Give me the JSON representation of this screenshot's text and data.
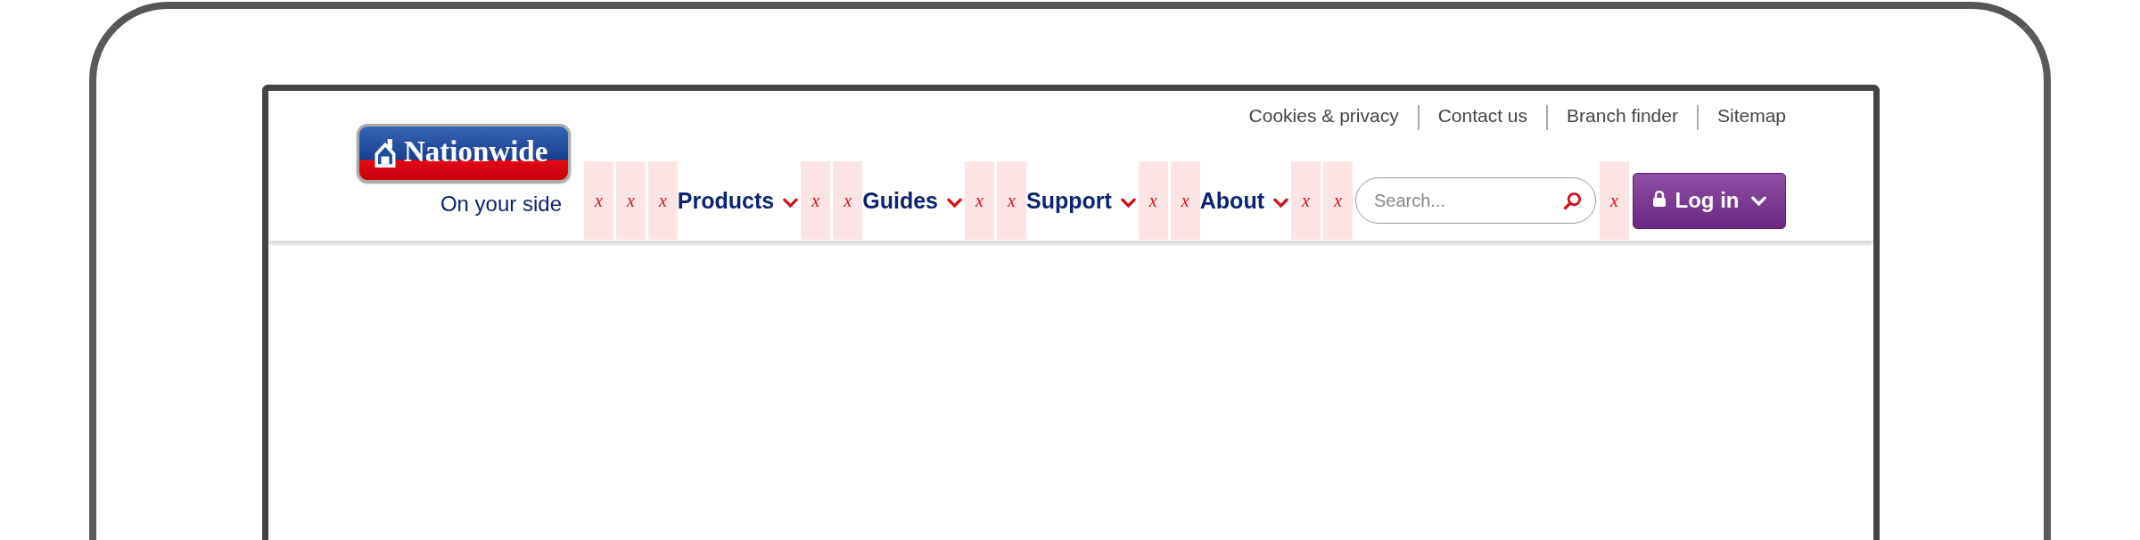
{
  "top_links": [
    "Cookies & privacy",
    "Contact us",
    "Branch finder",
    "Sitemap"
  ],
  "logo": {
    "text": "Nationwide"
  },
  "tagline": "On your side",
  "nav": [
    {
      "kind": "placeholder",
      "text": "x"
    },
    {
      "kind": "placeholder",
      "text": "x"
    },
    {
      "kind": "placeholder",
      "text": "x"
    },
    {
      "kind": "menu",
      "label": "Products"
    },
    {
      "kind": "placeholder",
      "text": "x"
    },
    {
      "kind": "placeholder",
      "text": "x"
    },
    {
      "kind": "menu",
      "label": "Guides"
    },
    {
      "kind": "placeholder",
      "text": "x"
    },
    {
      "kind": "placeholder",
      "text": "x"
    },
    {
      "kind": "menu",
      "label": "Support"
    },
    {
      "kind": "placeholder",
      "text": "x"
    },
    {
      "kind": "placeholder",
      "text": "x"
    },
    {
      "kind": "menu",
      "label": "About"
    },
    {
      "kind": "placeholder",
      "text": "x"
    },
    {
      "kind": "placeholder",
      "text": "x"
    },
    {
      "kind": "search",
      "placeholder": "Search..."
    },
    {
      "kind": "placeholder",
      "text": "x"
    },
    {
      "kind": "button",
      "label": "Log in"
    }
  ]
}
